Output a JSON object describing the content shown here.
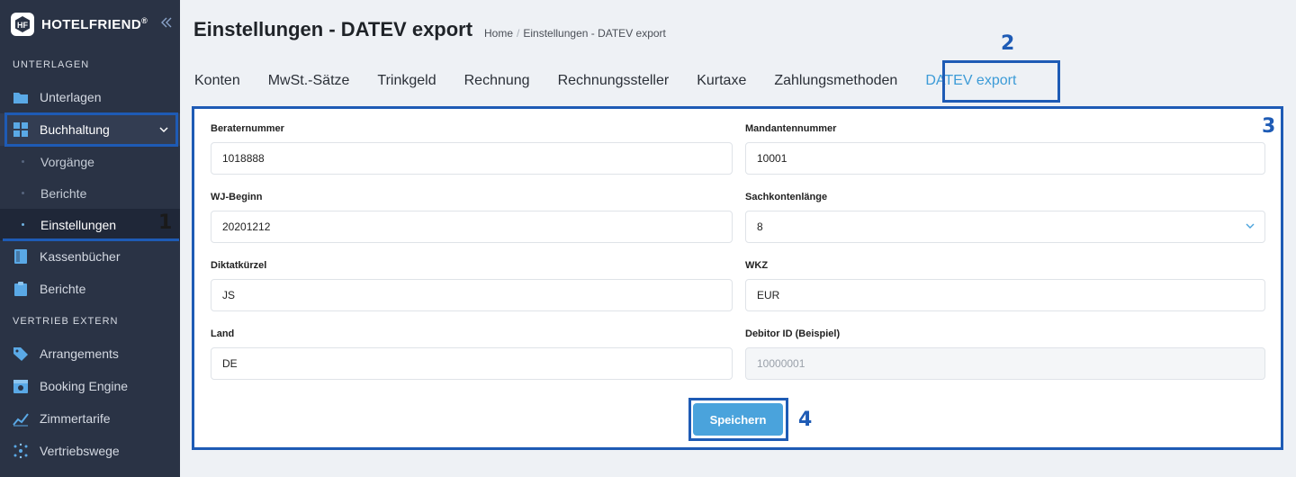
{
  "app": {
    "logo_text": "HOTELFRIEND",
    "logo_mark": "®"
  },
  "sidebar": {
    "section_unterlagen": "UNTERLAGEN",
    "unterlagen": "Unterlagen",
    "buchhaltung": "Buchhaltung",
    "sub": [
      "Vorgänge",
      "Berichte",
      "Einstellungen"
    ],
    "kassenbuecher": "Kassenbücher",
    "berichte": "Berichte",
    "section_vertrieb": "VERTRIEB EXTERN",
    "arrangements": "Arrangements",
    "booking_engine": "Booking Engine",
    "zimmertarife": "Zimmertarife",
    "vertriebswege": "Vertriebswege"
  },
  "header": {
    "title": "Einstellungen - DATEV export",
    "breadcrumb_home": "Home",
    "breadcrumb_separator": "/",
    "breadcrumb_current": "Einstellungen - DATEV export"
  },
  "tabs": [
    "Konten",
    "MwSt.-Sätze",
    "Trinkgeld",
    "Rechnung",
    "Rechnungssteller",
    "Kurtaxe",
    "Zahlungsmethoden",
    "DATEV export"
  ],
  "form": {
    "beraternummer_label": "Beraternummer",
    "beraternummer_value": "1018888",
    "mandantennummer_label": "Mandantennummer",
    "mandantennummer_value": "10001",
    "wj_beginn_label": "WJ-Beginn",
    "wj_beginn_value": "20201212",
    "sachkontenlaenge_label": "Sachkontenlänge",
    "sachkontenlaenge_value": "8",
    "diktatkuerzel_label": "Diktatkürzel",
    "diktatkuerzel_value": "JS",
    "wkz_label": "WKZ",
    "wkz_value": "EUR",
    "land_label": "Land",
    "land_value": "DE",
    "debitor_label": "Debitor ID (Beispiel)",
    "debitor_value": "10000001",
    "save_label": "Speichern"
  },
  "annotations": [
    "1",
    "2",
    "3",
    "4"
  ],
  "colors": {
    "accent": "#3c9bd7",
    "annotation": "#1e5bb5",
    "sidebar": "#2a3345"
  }
}
